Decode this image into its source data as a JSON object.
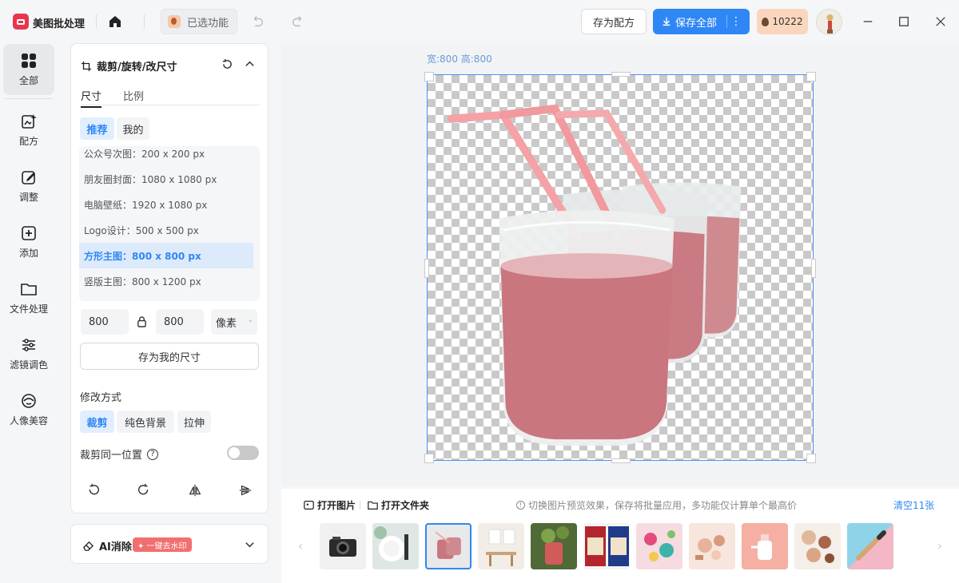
{
  "app": {
    "name": "美图批处理",
    "selected_features": "已选功能"
  },
  "header": {
    "save_preset": "存为配方",
    "save_all": "保存全部",
    "credits": "10222"
  },
  "rail": [
    {
      "label": "全部",
      "icon": "grid-icon"
    },
    {
      "label": "配方",
      "icon": "recipe-icon"
    },
    {
      "label": "调整",
      "icon": "edit-icon"
    },
    {
      "label": "添加",
      "icon": "add-icon"
    },
    {
      "label": "文件处理",
      "icon": "folder-icon"
    },
    {
      "label": "滤镜调色",
      "icon": "sliders-icon"
    },
    {
      "label": "人像美容",
      "icon": "face-icon"
    }
  ],
  "panel": {
    "title": "裁剪/旋转/改尺寸",
    "tabs": [
      "尺寸",
      "比例"
    ],
    "chips": [
      "推荐",
      "我的"
    ],
    "sizes": [
      "公众号次图：200 x 200 px",
      "朋友圈封面：1080 x 1080 px",
      "电脑壁纸：1920 x 1080 px",
      "Logo设计：500 x 500 px",
      "方形主图：800 x 800 px",
      "竖版主图：800 x 1200 px"
    ],
    "width": "800",
    "height": "800",
    "unit": "像素",
    "save_size": "存为我的尺寸",
    "mod_label": "修改方式",
    "mod_options": [
      "裁剪",
      "纯色背景",
      "拉伸"
    ],
    "same_position": "裁剪同一位置"
  },
  "ai": {
    "label": "AI消除",
    "badge": "✦ 一键去水印"
  },
  "canvas": {
    "dims": "宽:800  高:800"
  },
  "film": {
    "open_image": "打开图片",
    "open_folder": "打开文件夹",
    "hint": "切换图片预览效果，保存将批量应用，多功能仅计算单个最高价",
    "clear": "清空11张"
  }
}
